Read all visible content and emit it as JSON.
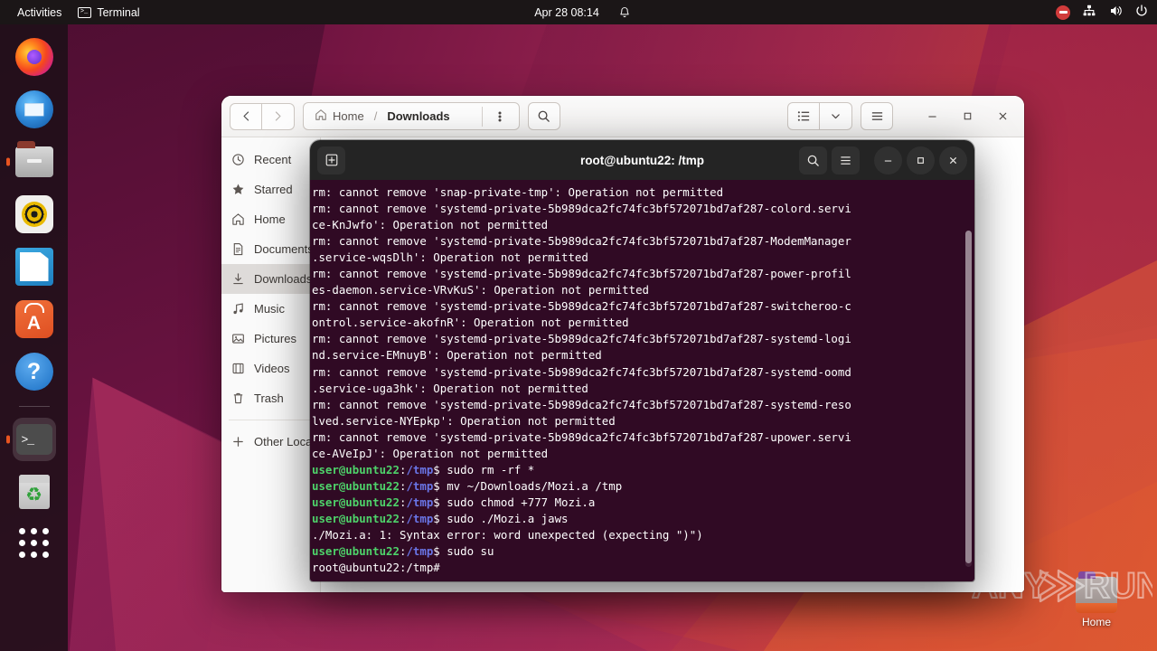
{
  "topbar": {
    "activities": "Activities",
    "app_name": "Terminal",
    "app_icon": "terminal-icon",
    "clock": "Apr 28  08:14",
    "notification_icon": "bell-icon",
    "indicators": [
      {
        "name": "recording-indicator",
        "icon": "record-stop-icon"
      },
      {
        "name": "network-indicator",
        "icon": "network-wired-icon"
      },
      {
        "name": "volume-indicator",
        "icon": "speaker-icon"
      },
      {
        "name": "power-indicator",
        "icon": "power-icon"
      }
    ]
  },
  "dock": {
    "items": [
      {
        "name": "firefox",
        "label": "Firefox Web Browser",
        "icon": "firefox-icon",
        "running": false
      },
      {
        "name": "thunderbird",
        "label": "Thunderbird Mail",
        "icon": "thunderbird-icon",
        "running": false
      },
      {
        "name": "files",
        "label": "Files",
        "icon": "files-folder-icon",
        "running": true
      },
      {
        "name": "rhythmbox",
        "label": "Rhythmbox",
        "icon": "rhythmbox-icon",
        "running": false
      },
      {
        "name": "libreoffice-writer",
        "label": "LibreOffice Writer",
        "icon": "document-icon",
        "running": false
      },
      {
        "name": "ubuntu-software",
        "label": "Ubuntu Software",
        "icon": "software-bag-icon",
        "running": false
      },
      {
        "name": "help",
        "label": "Help",
        "icon": "help-circle-icon",
        "running": false
      },
      {
        "name": "terminal",
        "label": "Terminal",
        "icon": "terminal-icon",
        "running": true
      },
      {
        "name": "trash",
        "label": "Trash",
        "icon": "trash-icon",
        "running": false
      }
    ],
    "show_apps_label": "Show Applications"
  },
  "desktop": {
    "home_icon_label": "Home"
  },
  "files_window": {
    "back_label": "Back",
    "forward_label": "Forward",
    "breadcrumb": [
      {
        "label": "Home",
        "icon": "home-icon",
        "current": false
      },
      {
        "label": "Downloads",
        "icon": "",
        "current": true
      }
    ],
    "breadcrumb_separator": "/",
    "path_menu_icon": "kebab-menu-icon",
    "search_icon": "search-icon",
    "view_list_icon": "list-view-icon",
    "view_dropdown_icon": "chevron-down-icon",
    "hamburger_icon": "hamburger-menu-icon",
    "minimize_label": "–",
    "maximize_label": "□",
    "close_label": "×",
    "sidebar": [
      {
        "label": "Recent",
        "icon": "clock-icon",
        "selected": false
      },
      {
        "label": "Starred",
        "icon": "star-icon",
        "selected": false
      },
      {
        "label": "Home",
        "icon": "home-icon",
        "selected": false
      },
      {
        "label": "Documents",
        "icon": "document-icon",
        "selected": false
      },
      {
        "label": "Downloads",
        "icon": "download-icon",
        "selected": true
      },
      {
        "label": "Music",
        "icon": "music-note-icon",
        "selected": false
      },
      {
        "label": "Pictures",
        "icon": "image-icon",
        "selected": false
      },
      {
        "label": "Videos",
        "icon": "film-icon",
        "selected": false
      },
      {
        "label": "Trash",
        "icon": "trash-icon",
        "selected": false
      }
    ],
    "other_locations": {
      "label": "Other Locations",
      "icon": "plus-icon"
    }
  },
  "terminal_window": {
    "title": "root@ubuntu22: /tmp",
    "new_tab_icon": "new-tab-icon",
    "search_icon": "search-icon",
    "menu_icon": "hamburger-menu-icon",
    "minimize_label": "–",
    "maximize_label": "□",
    "close_label": "×",
    "colors": {
      "background": "#300a24",
      "foreground": "#ffffff",
      "user_green": "#4ed36a",
      "path_blue": "#6a76e8",
      "header": "#242424"
    },
    "private_hash": "5b989dca2fc74fc3bf572071bd7af287",
    "lines": [
      [
        {
          "t": "plain",
          "s": "rm: cannot remove 'snap-private-tmp': Operation not permitted"
        }
      ],
      [
        {
          "t": "plain",
          "s": "rm: cannot remove 'systemd-private-5b989dca2fc74fc3bf572071bd7af287-colord.servi"
        }
      ],
      [
        {
          "t": "plain",
          "s": "ce-KnJwfo': Operation not permitted"
        }
      ],
      [
        {
          "t": "plain",
          "s": "rm: cannot remove 'systemd-private-5b989dca2fc74fc3bf572071bd7af287-ModemManager"
        }
      ],
      [
        {
          "t": "plain",
          "s": ".service-wqsDlh': Operation not permitted"
        }
      ],
      [
        {
          "t": "plain",
          "s": "rm: cannot remove 'systemd-private-5b989dca2fc74fc3bf572071bd7af287-power-profil"
        }
      ],
      [
        {
          "t": "plain",
          "s": "es-daemon.service-VRvKuS': Operation not permitted"
        }
      ],
      [
        {
          "t": "plain",
          "s": "rm: cannot remove 'systemd-private-5b989dca2fc74fc3bf572071bd7af287-switcheroo-c"
        }
      ],
      [
        {
          "t": "plain",
          "s": "ontrol.service-akofnR': Operation not permitted"
        }
      ],
      [
        {
          "t": "plain",
          "s": "rm: cannot remove 'systemd-private-5b989dca2fc74fc3bf572071bd7af287-systemd-logi"
        }
      ],
      [
        {
          "t": "plain",
          "s": "nd.service-EMnuyB': Operation not permitted"
        }
      ],
      [
        {
          "t": "plain",
          "s": "rm: cannot remove 'systemd-private-5b989dca2fc74fc3bf572071bd7af287-systemd-oomd"
        }
      ],
      [
        {
          "t": "plain",
          "s": ".service-uga3hk': Operation not permitted"
        }
      ],
      [
        {
          "t": "plain",
          "s": "rm: cannot remove 'systemd-private-5b989dca2fc74fc3bf572071bd7af287-systemd-reso"
        }
      ],
      [
        {
          "t": "plain",
          "s": "lved.service-NYEpkp': Operation not permitted"
        }
      ],
      [
        {
          "t": "plain",
          "s": "rm: cannot remove 'systemd-private-5b989dca2fc74fc3bf572071bd7af287-upower.servi"
        }
      ],
      [
        {
          "t": "plain",
          "s": "ce-AVeIpJ': Operation not permitted"
        }
      ],
      [
        {
          "t": "user",
          "s": "user@ubuntu22"
        },
        {
          "t": "plain",
          "s": ":"
        },
        {
          "t": "path",
          "s": "/tmp"
        },
        {
          "t": "plain",
          "s": "$ sudo rm -rf *"
        }
      ],
      [
        {
          "t": "user",
          "s": "user@ubuntu22"
        },
        {
          "t": "plain",
          "s": ":"
        },
        {
          "t": "path",
          "s": "/tmp"
        },
        {
          "t": "plain",
          "s": "$ mv ~/Downloads/Mozi.a /tmp"
        }
      ],
      [
        {
          "t": "user",
          "s": "user@ubuntu22"
        },
        {
          "t": "plain",
          "s": ":"
        },
        {
          "t": "path",
          "s": "/tmp"
        },
        {
          "t": "plain",
          "s": "$ sudo chmod +777 Mozi.a"
        }
      ],
      [
        {
          "t": "user",
          "s": "user@ubuntu22"
        },
        {
          "t": "plain",
          "s": ":"
        },
        {
          "t": "path",
          "s": "/tmp"
        },
        {
          "t": "plain",
          "s": "$ sudo ./Mozi.a jaws"
        }
      ],
      [
        {
          "t": "plain",
          "s": "./Mozi.a: 1: Syntax error: word unexpected (expecting \")\")"
        }
      ],
      [
        {
          "t": "user",
          "s": "user@ubuntu22"
        },
        {
          "t": "plain",
          "s": ":"
        },
        {
          "t": "path",
          "s": "/tmp"
        },
        {
          "t": "plain",
          "s": "$ sudo su"
        }
      ],
      [
        {
          "t": "plain",
          "s": "root@ubuntu22:/tmp#"
        }
      ]
    ]
  },
  "watermark": {
    "text_any": "ANY",
    "text_run": "RUN"
  }
}
